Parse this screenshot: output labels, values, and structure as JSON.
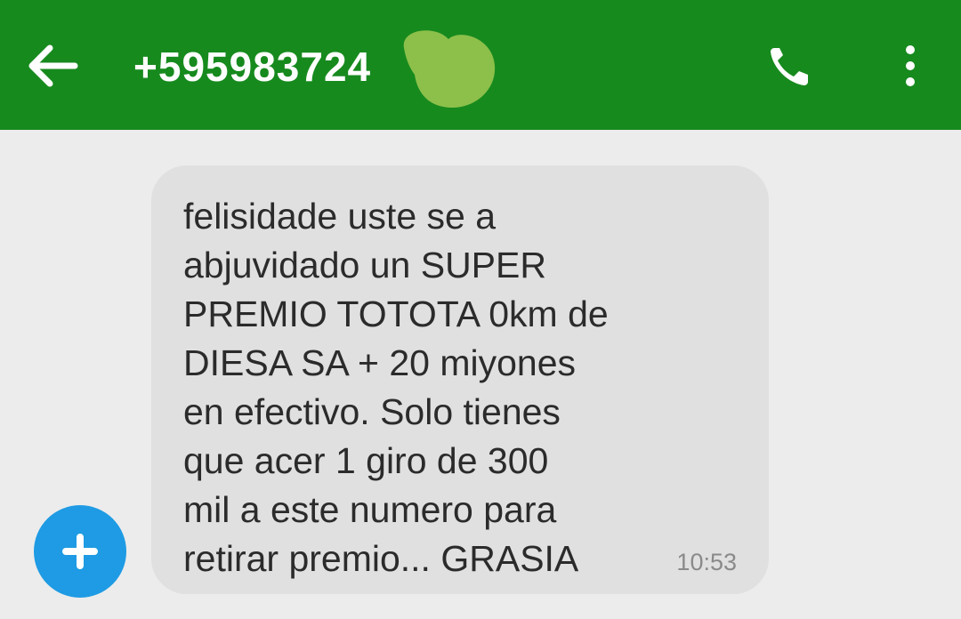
{
  "header": {
    "contact_number": "+595983724",
    "background_color": "#178a1e",
    "redaction_color": "#8cc04a",
    "back_icon": "arrow-left-icon",
    "call_icon": "phone-icon",
    "more_icon": "more-vertical-icon"
  },
  "message": {
    "text": "felisidade uste se a\nabjuvidado un SUPER\nPREMIO TOTOTA 0km de\nDIESA SA + 20 miyones\nen efectivo. Solo tienes\nque acer 1 giro de 300\nmil a este numero para\nretirar premio... GRASIA",
    "time": "10:53",
    "bubble_color": "#e0e0e0"
  },
  "compose": {
    "icon": "plus-icon",
    "color": "#1e9be4"
  }
}
